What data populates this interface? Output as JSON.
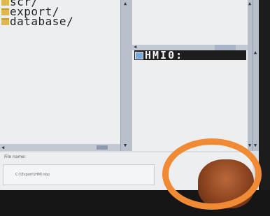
{
  "left_pane": {
    "items": [
      {
        "label": "scr/"
      },
      {
        "label": "export/"
      },
      {
        "label": "database/"
      }
    ]
  },
  "right_pane": {
    "selected_entry": "HMI0:"
  },
  "file_name": {
    "label": "File name:",
    "value": "C:\\\\Export\\\\HMI.nbp"
  },
  "colors": {
    "highlight_ring": "#f08a35",
    "folder": "#e0b84a",
    "selection": "#1d1d1d"
  }
}
